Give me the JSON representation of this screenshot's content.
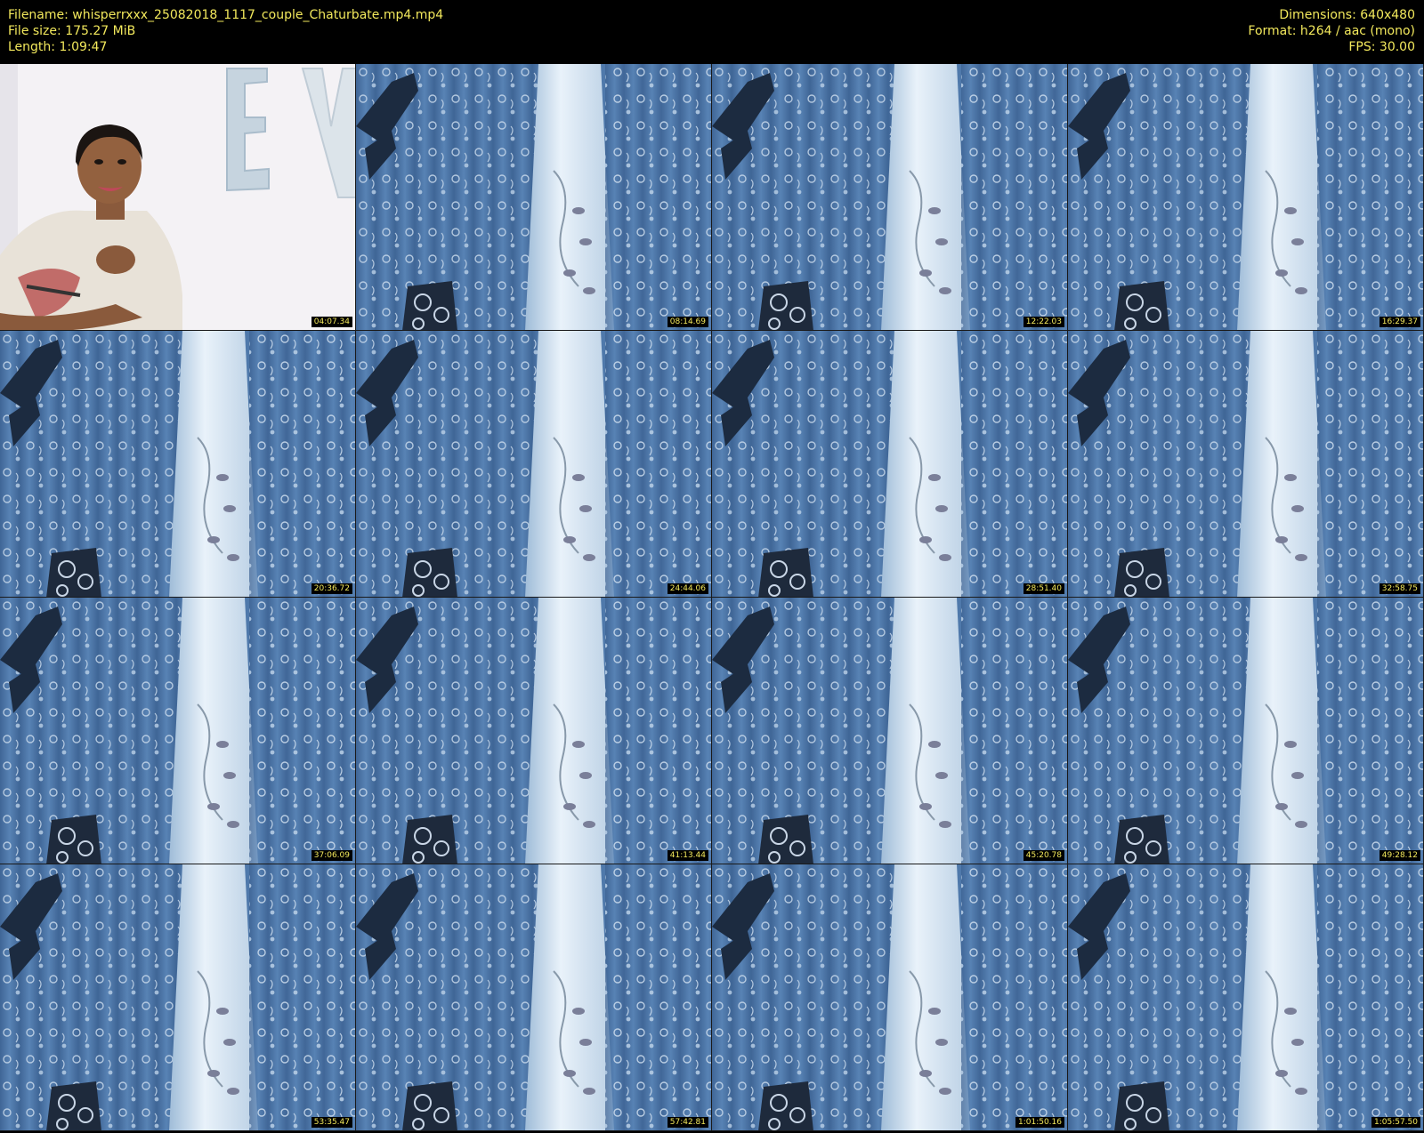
{
  "header": {
    "left": [
      "Filename: whisperrxxx_25082018_1117_couple_Chaturbate.mp4.mp4",
      "File size: 175.27 MiB",
      "Length: 1:09:47"
    ],
    "right": [
      "Dimensions: 640x480",
      "Format: h264 / aac (mono)",
      "FPS: 30.00"
    ]
  },
  "colors": {
    "text": "#f2e85c",
    "curtain": "#4f79ab",
    "curtain_dark": "#3d6596",
    "sheer": "#dce9f4"
  },
  "thumbnails": [
    {
      "timestamp": "04:07.34",
      "scene": "person"
    },
    {
      "timestamp": "08:14.69",
      "scene": "curtain"
    },
    {
      "timestamp": "12:22.03",
      "scene": "curtain"
    },
    {
      "timestamp": "16:29.37",
      "scene": "curtain"
    },
    {
      "timestamp": "20:36.72",
      "scene": "curtain"
    },
    {
      "timestamp": "24:44.06",
      "scene": "curtain"
    },
    {
      "timestamp": "28:51.40",
      "scene": "curtain"
    },
    {
      "timestamp": "32:58.75",
      "scene": "curtain"
    },
    {
      "timestamp": "37:06.09",
      "scene": "curtain"
    },
    {
      "timestamp": "41:13.44",
      "scene": "curtain"
    },
    {
      "timestamp": "45:20.78",
      "scene": "curtain"
    },
    {
      "timestamp": "49:28.12",
      "scene": "curtain"
    },
    {
      "timestamp": "53:35.47",
      "scene": "curtain"
    },
    {
      "timestamp": "57:42.81",
      "scene": "curtain"
    },
    {
      "timestamp": "1:01:50.16",
      "scene": "curtain"
    },
    {
      "timestamp": "1:05:57.50",
      "scene": "curtain"
    }
  ]
}
